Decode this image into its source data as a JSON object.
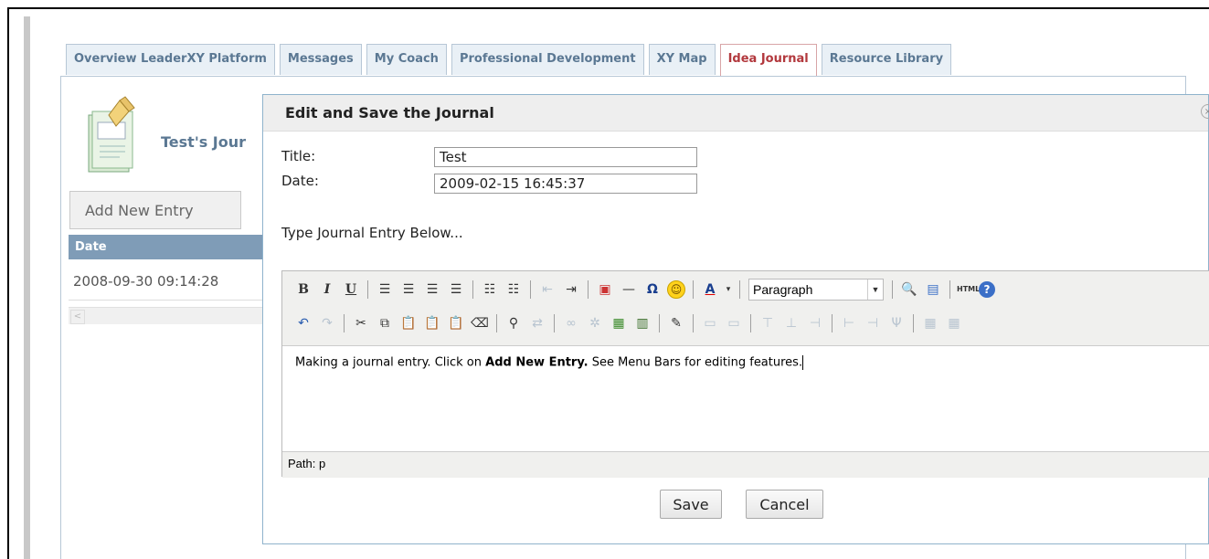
{
  "tabs": [
    {
      "label": "Overview LeaderXY Platform",
      "active": false
    },
    {
      "label": "Messages",
      "active": false
    },
    {
      "label": "My Coach",
      "active": false
    },
    {
      "label": "Professional Development",
      "active": false
    },
    {
      "label": "XY Map",
      "active": false
    },
    {
      "label": "Idea Journal",
      "active": true
    },
    {
      "label": "Resource Library",
      "active": false
    }
  ],
  "journal": {
    "title": "Test's Jour",
    "add_button": "Add New Entry",
    "grid_header": "Date",
    "rows": [
      "2008-09-30 09:14:28"
    ]
  },
  "dialog": {
    "title": "Edit and Save the Journal",
    "close_glyph": "×",
    "title_label": "Title:",
    "title_value": "Test",
    "date_label": "Date:",
    "date_value": "2009-02-15 16:45:37",
    "instructions": "Type Journal Entry Below...",
    "format_value": "Paragraph",
    "content_before": "Making a journal entry. Click on ",
    "content_bold": "Add New Entry.",
    "content_after": " See Menu Bars for editing features.",
    "path": "Path: p",
    "save_label": "Save",
    "cancel_label": "Cancel"
  },
  "colors": {
    "tab_text": "#5b7893",
    "active_tab_text": "#b2383d",
    "grid_header_bg": "#7f9cb7",
    "dialog_border": "#8fb3cc"
  }
}
